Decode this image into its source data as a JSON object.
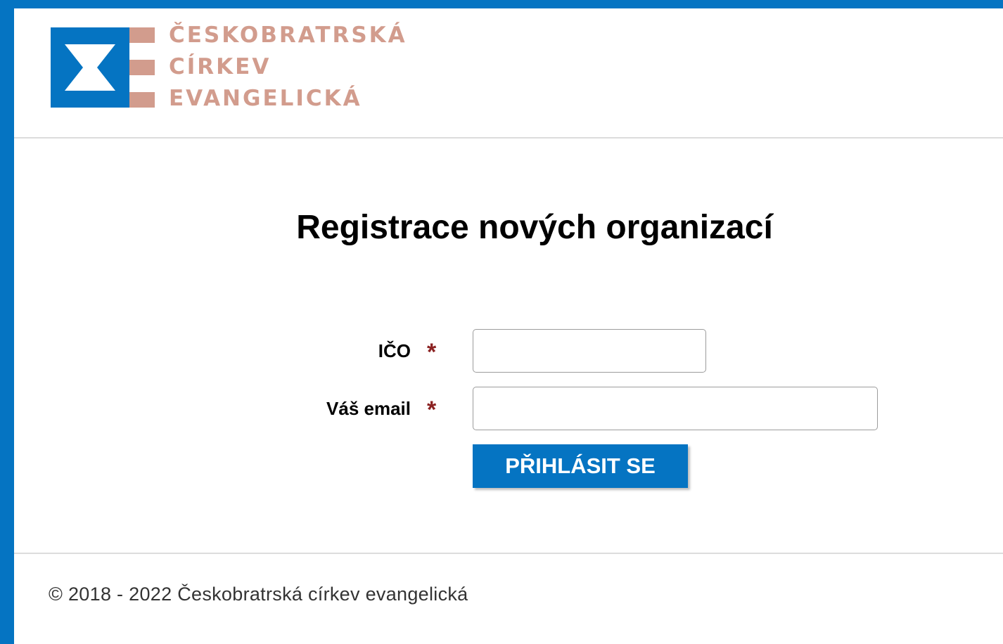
{
  "brand": {
    "logo_line_1": "ČESKOBRATRSKÁ",
    "logo_line_2": "CÍRKEV",
    "logo_line_3": "EVANGELICKÁ",
    "logo_blue": "#0574c2",
    "logo_pink": "#d29c8d"
  },
  "main": {
    "title": "Registrace nových organizací",
    "form": {
      "ico_label": "IČO",
      "ico_value": "",
      "email_label": "Váš email",
      "email_value": "",
      "required_marker": "*",
      "submit_label": "PŘIHLÁSIT SE"
    }
  },
  "footer": {
    "copyright": "© 2018 - 2022 Českobratrská církev evangelická"
  },
  "colors": {
    "frame": "#0574c2",
    "button": "#0574c2",
    "required": "#8b2222"
  }
}
